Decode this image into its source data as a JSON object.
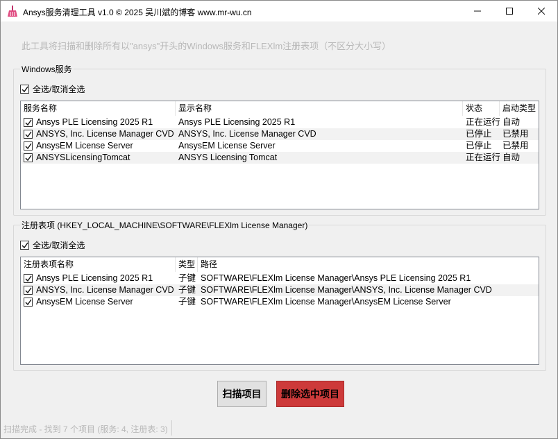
{
  "window": {
    "title": "Ansys服务清理工具 v1.0 © 2025 吴川斌的博客 www.mr-wu.cn",
    "min_glyph": "—",
    "max_glyph": "☐",
    "close_glyph": "✕",
    "icon": "broom-icon"
  },
  "description": "此工具将扫描和删除所有以\"ansys\"开头的Windows服务和FLEXlm注册表项（不区分大小写）",
  "services": {
    "group_title": "Windows服务",
    "select_all_label": "全选/取消全选",
    "select_all_checked": true,
    "columns": [
      "服务名称",
      "显示名称",
      "状态",
      "启动类型"
    ],
    "rows": [
      {
        "checked": true,
        "name": "Ansys PLE Licensing 2025 R1",
        "display": "Ansys PLE Licensing 2025 R1",
        "status": "正在运行",
        "startup": "自动"
      },
      {
        "checked": true,
        "name": "ANSYS, Inc. License Manager CVD",
        "display": "ANSYS, Inc. License Manager CVD",
        "status": "已停止",
        "startup": "已禁用"
      },
      {
        "checked": true,
        "name": "AnsysEM License Server",
        "display": "AnsysEM License Server",
        "status": "已停止",
        "startup": "已禁用"
      },
      {
        "checked": true,
        "name": "ANSYSLicensingTomcat",
        "display": "ANSYS Licensing Tomcat",
        "status": "正在运行",
        "startup": "自动"
      }
    ]
  },
  "registry": {
    "group_title": "注册表项 (HKEY_LOCAL_MACHINE\\SOFTWARE\\FLEXlm License Manager)",
    "select_all_label": "全选/取消全选",
    "select_all_checked": true,
    "columns": [
      "注册表项名称",
      "类型",
      "路径"
    ],
    "rows": [
      {
        "checked": true,
        "name": "Ansys PLE Licensing 2025 R1",
        "type": "子键",
        "path": "SOFTWARE\\FLEXlm License Manager\\Ansys PLE Licensing 2025 R1"
      },
      {
        "checked": true,
        "name": "ANSYS, Inc. License Manager CVD",
        "type": "子键",
        "path": "SOFTWARE\\FLEXlm License Manager\\ANSYS, Inc. License Manager CVD"
      },
      {
        "checked": true,
        "name": "AnsysEM License Server",
        "type": "子键",
        "path": "SOFTWARE\\FLEXlm License Manager\\AnsysEM License Server"
      }
    ]
  },
  "buttons": {
    "scan_label": "扫描项目",
    "delete_label": "删除选中项目",
    "delete_color": "#cd3a3a"
  },
  "status_text": "扫描完成 - 找到 7 个项目 (服务: 4, 注册表: 3)"
}
